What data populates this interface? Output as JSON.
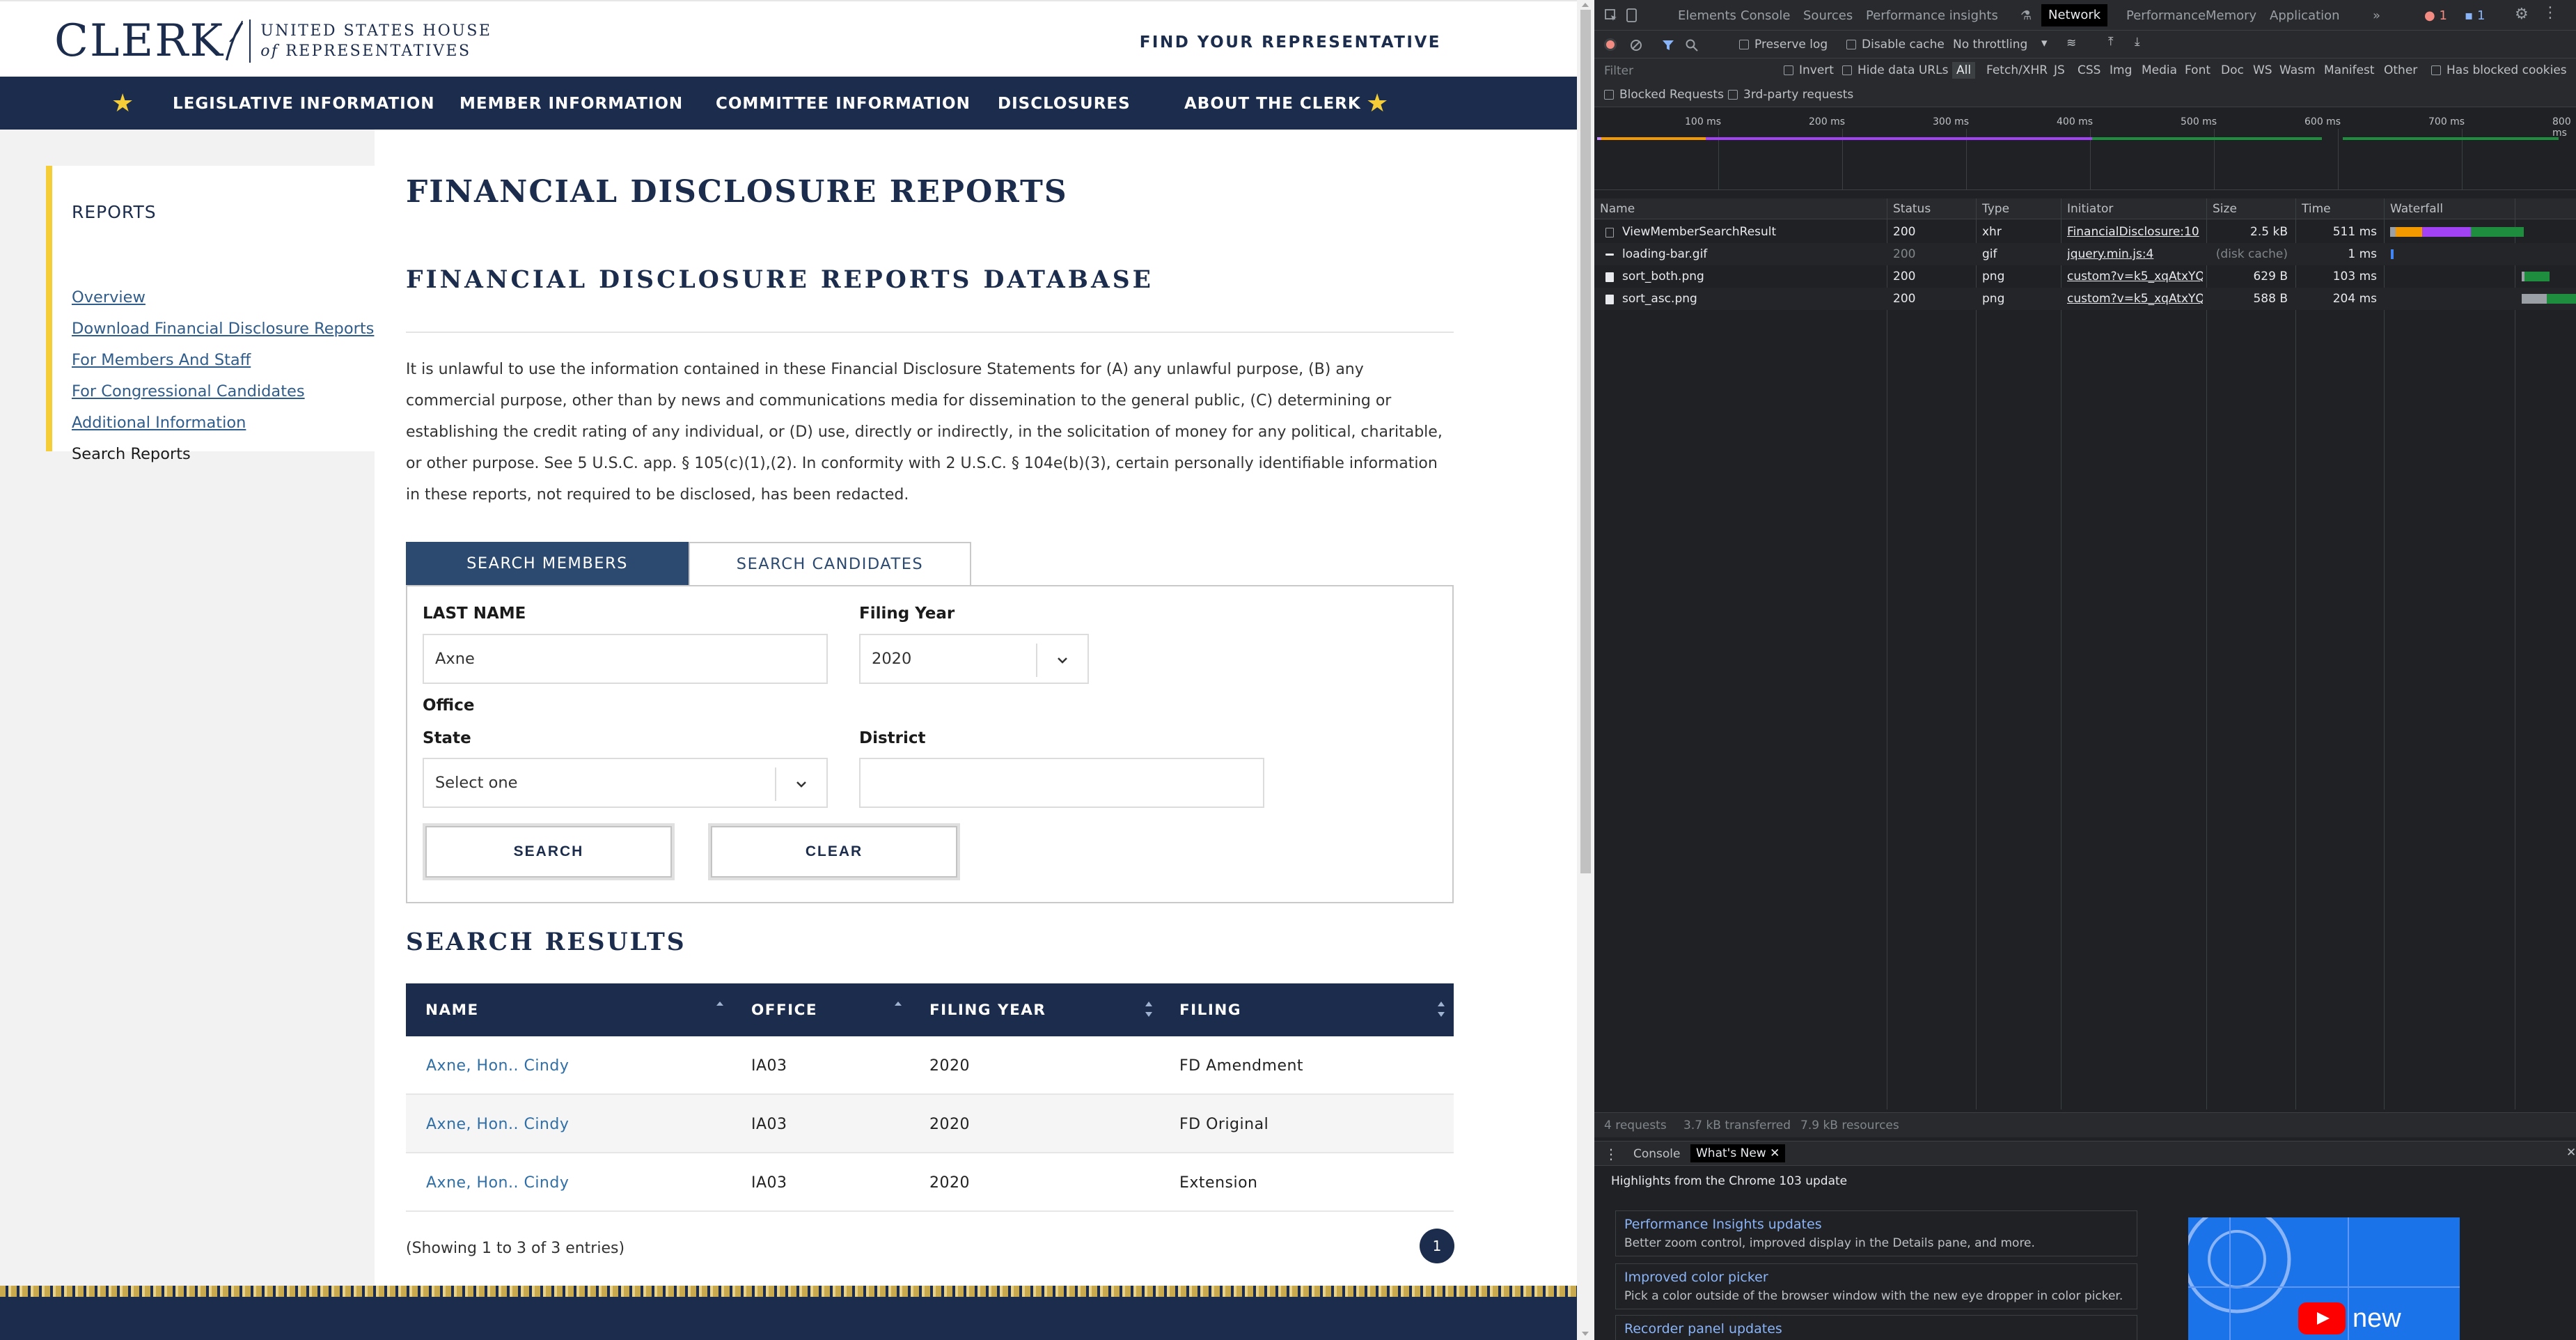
{
  "site": {
    "logo": {
      "word": "CLERK",
      "line1": "UNITED STATES HOUSE",
      "line2_italic": "of",
      "line2": "REPRESENTATIVES"
    },
    "header_link": "FIND YOUR REPRESENTATIVE",
    "nav": [
      "LEGISLATIVE INFORMATION",
      "MEMBER INFORMATION",
      "COMMITTEE INFORMATION",
      "DISCLOSURES",
      "ABOUT THE CLERK"
    ],
    "sidebar": {
      "title": "REPORTS",
      "links": [
        "Overview",
        "Download Financial Disclosure Reports",
        "For Members And Staff",
        "For Congressional Candidates",
        "Additional Information"
      ],
      "current": "Search Reports"
    },
    "page_title": "FINANCIAL DISCLOSURE REPORTS",
    "db_title": "FINANCIAL DISCLOSURE REPORTS DATABASE",
    "disclaimer": "It is unlawful to use the information contained in these Financial Disclosure Statements for (A) any unlawful purpose, (B) any commercial purpose, other than by news and communications media for dissemination to the general public, (C) determining or establishing the credit rating of any individual, or (D) use, directly or indirectly, in the solicitation of money for any political, charitable, or other purpose. See 5 U.S.C. app. § 105(c)(1),(2). In conformity with 2 U.S.C. § 104e(b)(3), certain personally identifiable information in these reports, not required to be disclosed, has been redacted.",
    "tabs": {
      "active": "SEARCH MEMBERS",
      "inactive": "SEARCH CANDIDATES"
    },
    "form": {
      "last_name_label": "LAST NAME",
      "last_name_value": "Axne",
      "filing_year_label": "Filing Year",
      "filing_year_value": "2020",
      "office_label": "Office",
      "state_label": "State",
      "state_value": "Select one",
      "district_label": "District",
      "district_value": "",
      "search_button": "SEARCH",
      "clear_button": "CLEAR"
    },
    "results_title": "SEARCH RESULTS",
    "table": {
      "headers": [
        "NAME",
        "OFFICE",
        "FILING YEAR",
        "FILING"
      ],
      "rows": [
        {
          "name": "Axne, Hon.. Cindy",
          "office": "IA03",
          "year": "2020",
          "filing": "FD Amendment"
        },
        {
          "name": "Axne, Hon.. Cindy",
          "office": "IA03",
          "year": "2020",
          "filing": "FD Original"
        },
        {
          "name": "Axne, Hon.. Cindy",
          "office": "IA03",
          "year": "2020",
          "filing": "Extension"
        }
      ]
    },
    "showing": "(Showing 1 to 3 of 3 entries)",
    "page": "1",
    "colors": {
      "navy": "#1b2c4c",
      "gold": "#f4cd39",
      "link": "#2f6fa8"
    }
  },
  "devtools": {
    "tabs": [
      "Elements",
      "Console",
      "Sources",
      "Performance insights",
      "Network",
      "Performance",
      "Memory",
      "Application"
    ],
    "active_tab": "Network",
    "badges": {
      "errors": "1",
      "messages": "1"
    },
    "toolbar": {
      "preserve_log": "Preserve log",
      "disable_cache": "Disable cache",
      "throttling": "No throttling"
    },
    "filter": {
      "placeholder": "Filter",
      "invert": "Invert",
      "hide_data_urls": "Hide data URLs",
      "types": [
        "All",
        "Fetch/XHR",
        "JS",
        "CSS",
        "Img",
        "Media",
        "Font",
        "Doc",
        "WS",
        "Wasm",
        "Manifest",
        "Other"
      ],
      "has_blocked_cookies": "Has blocked cookies",
      "blocked_requests": "Blocked Requests",
      "third_party": "3rd-party requests"
    },
    "timeline_ticks": [
      "100 ms",
      "200 ms",
      "300 ms",
      "400 ms",
      "500 ms",
      "600 ms",
      "700 ms",
      "800 ms"
    ],
    "columns": [
      "Name",
      "Status",
      "Type",
      "Initiator",
      "Size",
      "Time",
      "Waterfall"
    ],
    "requests": [
      {
        "name": "ViewMemberSearchResult",
        "status": "200",
        "type": "xhr",
        "initiator": "FinancialDisclosure:10",
        "size": "2.5 kB",
        "time": "511 ms"
      },
      {
        "name": "loading-bar.gif",
        "status": "200",
        "type": "gif",
        "initiator": "jquery.min.js:4",
        "size": "(disk cache)",
        "time": "1 ms"
      },
      {
        "name": "sort_both.png",
        "status": "200",
        "type": "png",
        "initiator": "custom?v=k5_xqAtxYQ...",
        "size": "629 B",
        "time": "103 ms"
      },
      {
        "name": "sort_asc.png",
        "status": "200",
        "type": "png",
        "initiator": "custom?v=k5_xqAtxYQ...",
        "size": "588 B",
        "time": "204 ms"
      }
    ],
    "summary": [
      "4 requests",
      "3.7 kB transferred",
      "7.9 kB resources"
    ],
    "drawer_tabs": [
      "Console",
      "What's New"
    ],
    "whats_new": {
      "heading": "Highlights from the Chrome 103 update",
      "items": [
        {
          "title": "Performance Insights updates",
          "desc": "Better zoom control, improved display in the Details pane, and more."
        },
        {
          "title": "Improved color picker",
          "desc": "Pick a color outside of the browser window with the new eye dropper in color picker."
        },
        {
          "title": "Recorder panel updates",
          "desc": ""
        }
      ],
      "image_caption": "new"
    }
  }
}
